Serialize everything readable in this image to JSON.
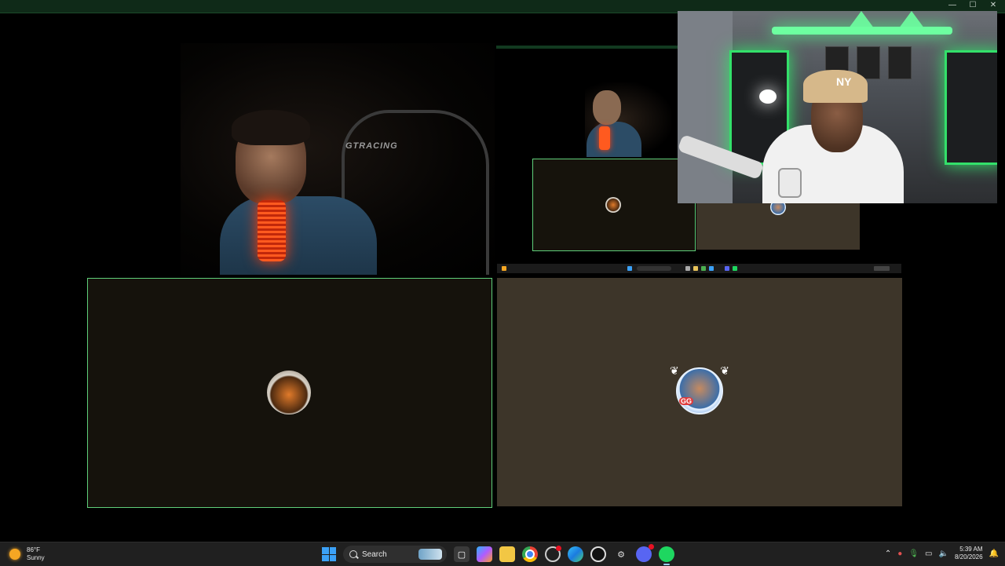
{
  "weather": {
    "temperature": "86°F",
    "condition": "Sunny",
    "icon": "sun-icon"
  },
  "taskbar": {
    "search_label": "Search",
    "apps": [
      {
        "name": "file-explorer-icon"
      },
      {
        "name": "copilot-icon"
      },
      {
        "name": "folder-icon"
      },
      {
        "name": "chrome-icon"
      },
      {
        "name": "app-icon"
      },
      {
        "name": "edge-icon"
      },
      {
        "name": "obs-icon"
      },
      {
        "name": "steam-icon"
      },
      {
        "name": "discord-icon"
      },
      {
        "name": "spotify-icon"
      }
    ]
  },
  "clock": {
    "time": "5:39 AM",
    "date": "8/20/2026"
  },
  "stream_overlay": {
    "chair_brand": "GTRACING",
    "cap_logo": "NY",
    "tile_badge": "GG"
  },
  "colors": {
    "speaking_border": "#5fd07a",
    "tile_dark": "#15120c",
    "tile_warm": "#3d3529",
    "accent_led": "#33e06a"
  }
}
